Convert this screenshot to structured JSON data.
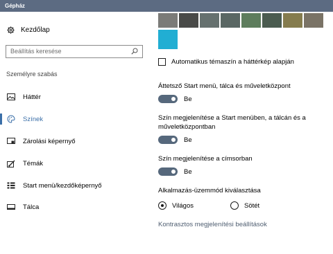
{
  "window": {
    "title": "Gépház"
  },
  "sidebar": {
    "home_label": "Kezdőlap",
    "search_placeholder": "Beállítás keresése",
    "section_label": "Személyre szabás",
    "items": [
      {
        "label": "Háttér",
        "icon": "image-icon"
      },
      {
        "label": "Színek",
        "icon": "palette-icon",
        "active": true
      },
      {
        "label": "Zárolási képernyő",
        "icon": "lock-screen-icon"
      },
      {
        "label": "Témák",
        "icon": "brush-icon"
      },
      {
        "label": "Start menü/kezdőképernyő",
        "icon": "start-grid-icon"
      },
      {
        "label": "Tálca",
        "icon": "taskbar-icon"
      }
    ]
  },
  "colors": {
    "swatches": [
      "#7b7b78",
      "#494a48",
      "#66716f",
      "#5a6764",
      "#5e7d5d",
      "#4b5c50",
      "#857c4e",
      "#7a7366"
    ],
    "selected_swatch": "#21aed3",
    "accent": "#3b6fa8",
    "toggle_on": "#56687c"
  },
  "main": {
    "auto_accent_label": "Automatikus témaszín a háttérkép alapján",
    "transparency": {
      "label": "Áttetsző Start menü, tálca és műveletközpont",
      "state": "Be"
    },
    "show_color_start": {
      "label": "Szín megjelenítése a Start menüben, a tálcán és a műveletközpontban",
      "state": "Be"
    },
    "show_color_title": {
      "label": "Szín megjelenítése a címsorban",
      "state": "Be"
    },
    "app_mode": {
      "label": "Alkalmazás-üzemmód kiválasztása",
      "options": [
        {
          "label": "Világos",
          "selected": true
        },
        {
          "label": "Sötét",
          "selected": false
        }
      ]
    },
    "contrast_link": "Kontrasztos megjelenítési beállítások"
  }
}
